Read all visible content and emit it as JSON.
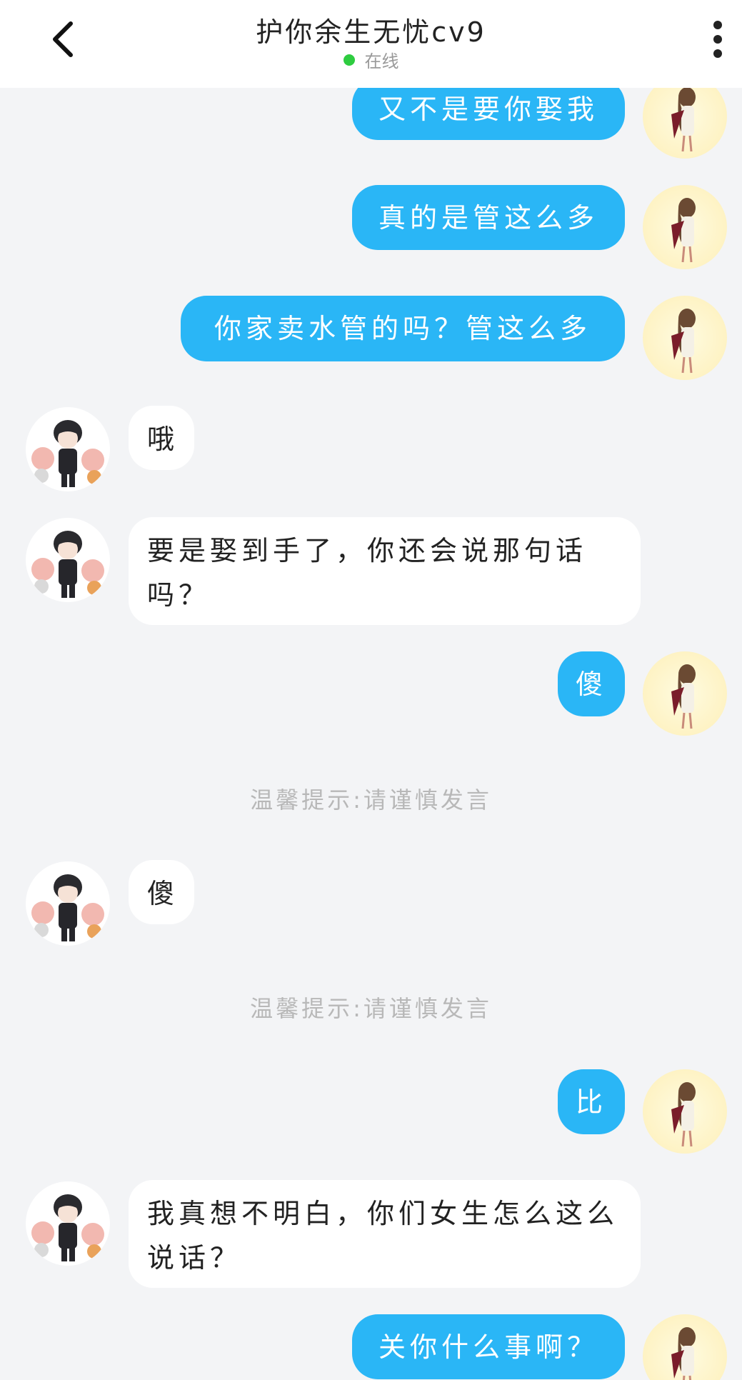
{
  "colors": {
    "bubble_mine": "#2ab6f6",
    "online_dot": "#2ecc40",
    "background": "#f3f4f6"
  },
  "header": {
    "title": "护你余生无忧cv9",
    "status": "在线",
    "back_icon": "chevron-left-icon",
    "more_icon": "more-vertical-icon"
  },
  "messages": [
    {
      "side": "me",
      "text": "又不是要你娶我"
    },
    {
      "side": "me",
      "text": "真的是管这么多"
    },
    {
      "side": "me",
      "text": "你家卖水管的吗？管这么多"
    },
    {
      "side": "them",
      "text": "哦"
    },
    {
      "side": "them",
      "text": "要是娶到手了，你还会说那句话吗？"
    },
    {
      "side": "me",
      "text": "傻"
    },
    {
      "side": "notice",
      "text": "温馨提示:请谨慎发言"
    },
    {
      "side": "them",
      "text": "傻"
    },
    {
      "side": "notice",
      "text": "温馨提示:请谨慎发言"
    },
    {
      "side": "me",
      "text": "比"
    },
    {
      "side": "them",
      "text": "我真想不明白，你们女生怎么这么说话？"
    },
    {
      "side": "me",
      "text": "关你什么事啊？"
    }
  ]
}
